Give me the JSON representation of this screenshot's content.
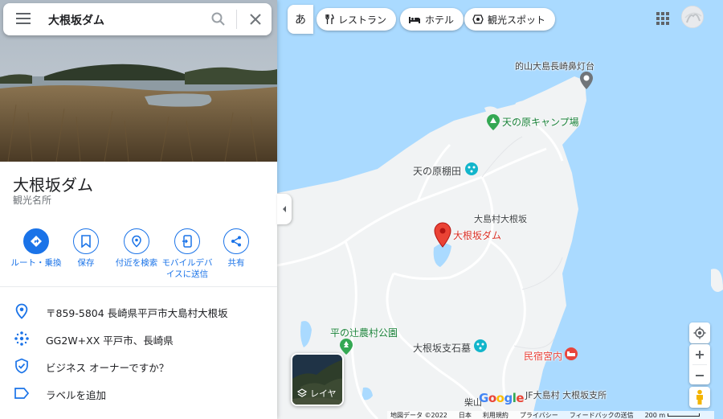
{
  "search": {
    "query": "大根坂ダム"
  },
  "place": {
    "title": "大根坂ダム",
    "category": "観光名所"
  },
  "actions": [
    {
      "label": "ルート・乗換"
    },
    {
      "label": "保存"
    },
    {
      "label": "付近を検索"
    },
    {
      "label": "モバイルデバイスに送信"
    },
    {
      "label": "共有"
    }
  ],
  "info": {
    "address": "〒859-5804 長崎県平戸市大島村大根坂",
    "plus_code": "GG2W+XX 平戸市、長崎県",
    "business": "ビジネス オーナーですか？",
    "add_label": "ラベルを追加"
  },
  "chips": {
    "lang": "あ",
    "restaurant": "レストラン",
    "hotel": "ホテル",
    "sightseeing": "観光スポット"
  },
  "map_labels": {
    "lighthouse": "的山大島長崎鼻灯台",
    "camp": "天の原キャンプ場",
    "terraces": "天の原棚田",
    "village": "大島村大根坂",
    "dam": "大根坂ダム",
    "park": "平の辻農村公園",
    "grave": "大根坂支石墓",
    "inn": "民宿宮内",
    "ja": "JF大島村 大根坂支所",
    "shibayama": "柴山"
  },
  "layer_label": "レイヤ",
  "footer": {
    "map_data": "地図データ ©2022",
    "japan": "日本",
    "terms": "利用規約",
    "privacy": "プライバシー",
    "feedback": "フィードバックの送信",
    "scale": "200 m"
  },
  "colors": {
    "water": "#aadaff",
    "land": "#f1f3f4",
    "accent": "#1a73e8",
    "pin": "#ea4335"
  }
}
